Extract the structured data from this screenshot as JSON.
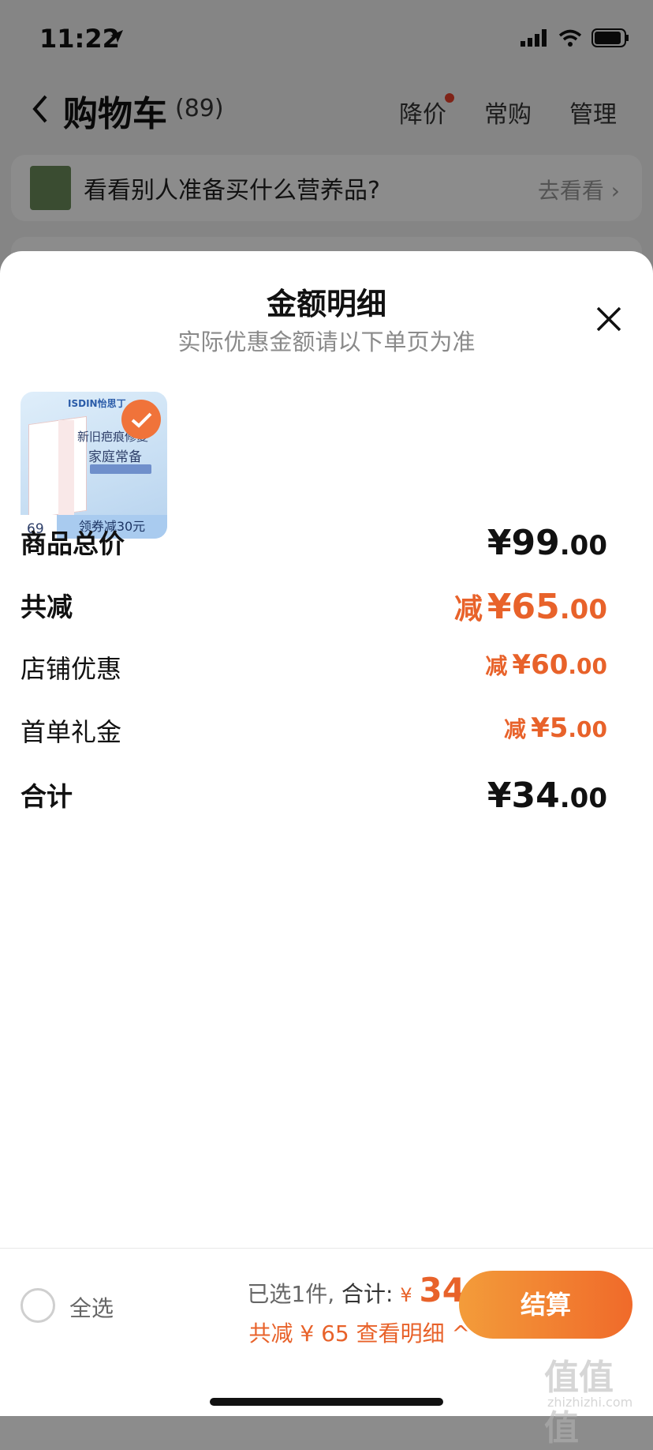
{
  "status_bar": {
    "time": "11:22"
  },
  "nav": {
    "title": "购物车",
    "count": "(89)",
    "actions": [
      "降价",
      "常购",
      "管理"
    ]
  },
  "promo": {
    "text": "看看别人准备买什么营养品?",
    "link": "去看看"
  },
  "sheet": {
    "title": "金额明细",
    "subtitle": "实际优惠金额请以下单页为准",
    "product": {
      "brand": "ISDIN怡思丁",
      "line1": "新旧疤痕修复",
      "line2": "家庭常备",
      "price": "69",
      "coupon": "领券减30元"
    },
    "rows": [
      {
        "label": "商品总价",
        "prefix": "",
        "int": "¥99",
        "dec": ".00"
      },
      {
        "label": "共减",
        "prefix": "减",
        "int": "¥65",
        "dec": ".00"
      },
      {
        "label": "店铺优惠",
        "prefix": "减",
        "int": "¥60",
        "dec": ".00"
      },
      {
        "label": "首单礼金",
        "prefix": "减",
        "int": "¥5",
        "dec": ".00"
      },
      {
        "label": "合计",
        "prefix": "",
        "int": "¥34",
        "dec": ".00"
      }
    ]
  },
  "bottom": {
    "select_all": "全选",
    "selected": "已选1件,",
    "total_label": "合计:",
    "currency": "¥",
    "total_amount": "34",
    "discount_line": "共减 ¥ 65  查看明细 ^",
    "checkout": "结算"
  },
  "watermark": {
    "text": "值值值",
    "sub": "zhizhizhi.com"
  },
  "colors": {
    "accent": "#e8622a",
    "checkout_start": "#f39c3a",
    "checkout_end": "#f06a2a"
  }
}
